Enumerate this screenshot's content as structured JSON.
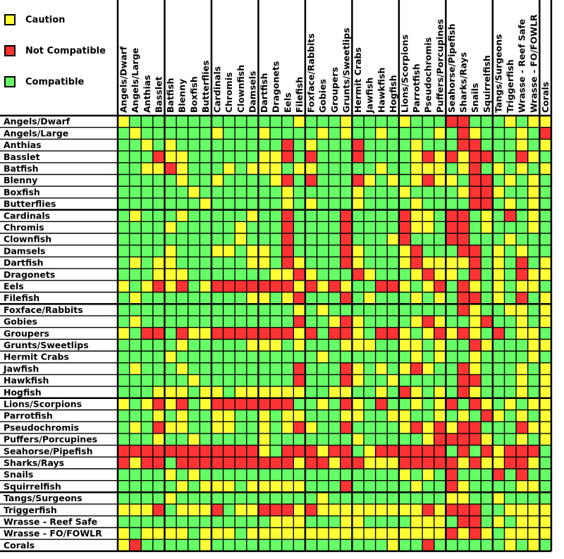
{
  "chart_data": {
    "type": "heatmap",
    "title": "",
    "legend": [
      {
        "key": "Y",
        "label": "Caution",
        "color": "#ffff33"
      },
      {
        "key": "R",
        "label": "Not Compatible",
        "color": "#ff3333"
      },
      {
        "key": "G",
        "label": "Compatible",
        "color": "#66ff66"
      }
    ],
    "legend_position": "top-left",
    "columns": [
      "Angels/Dwarf",
      "Angels/Large",
      "Anthias",
      "Basslet",
      "Batfish",
      "Blenny",
      "Boxfish",
      "Butterflies",
      "Cardinals",
      "Chromis",
      "Clownfish",
      "Damsels",
      "Dartfish",
      "Dragonets",
      "Eels",
      "Filefish",
      "Foxface/Rabbits",
      "Gobies",
      "Groupers",
      "Grunts/Sweetlips",
      "Hermit Crabs",
      "Jawfish",
      "Hawkfish",
      "Hogfish",
      "Lions/Scorpions",
      "Parrotfish",
      "Pseudochromis",
      "Puffers/Porcupines",
      "Seahorse/Pipefish",
      "Sharks/Rays",
      "Snails",
      "Squirrelfish",
      "Tangs/Surgeons",
      "Triggerfish",
      "Wrasse - Reef Safe",
      "Wrasse - FO/FOWLR",
      "Corals"
    ],
    "rows": [
      "Angels/Dwarf",
      "Angels/Large",
      "Anthias",
      "Basslet",
      "Batfish",
      "Blenny",
      "Boxfish",
      "Butterflies",
      "Cardinals",
      "Chromis",
      "Clownfish",
      "Damsels",
      "Dartfish",
      "Dragonets",
      "Eels",
      "Filefish",
      "Foxface/Rabbits",
      "Gobies",
      "Groupers",
      "Grunts/Sweetlips",
      "Hermit Crabs",
      "Jawfish",
      "Hawkfish",
      "Hogfish",
      "Lions/Scorpions",
      "Parrotfish",
      "Pseudochromis",
      "Puffers/Porcupines",
      "Seahorse/Pipefish",
      "Sharks/Rays",
      "Snails",
      "Squirrelfish",
      "Tangs/Surgeons",
      "Triggerfish",
      "Wrasse - Reef Safe",
      "Wrasse - FO/FOWLR",
      "Corals"
    ],
    "values": [
      "YGGGGGGGGGGGGGGYGGGYGGGGYGGGRRGGGYGYY",
      "GYGGGGGGYGGGYGGGGYGYGGYGGGGYGRYGGGYGR",
      "GGYGYGGGGGGGGGRGYGGGRGGGGYGGGRRGGGYGY",
      "GGGRYYGGGGGGYYRGRGGGRGGGGYRYRYRRGGRYG",
      "GGYYRYGGGYGYYYGYYGGGGGYGGYYYGYRGYGYGY",
      "GGGGGYGGYGGGGYRGRGGGRYGYGYRYYGRRGYGYG",
      "GGGGGGYGGGGGGGYGGGGGYGGGYGGGGYRRYGGYGG",
      "GGGGGGGYGGGGGGYGYGGGYGGGGYGGGGRRGYGYGYY",
      "GYGGGYGGGGGYGGRGGGGRGGGGRYYGRRGYGRGYG",
      "GGGGYGGGGGYGGGRGGGGRGGGGRYYGRRGYGGGYG",
      "GGGGGGGGGGYGGGRGGGGRGGGYRGGGRRGGGYGGG",
      "GGGGYGGGYYGYYGRGGGGRYGGGYRGGGRRGYGYGG",
      "GYGYYGGGGGGYYGRYGGGRYGGGYRYYYYRGYGRGY",
      "GGGYYYGGGGGGGYYRYGGGRYGGGYRYYGRGYGRYY",
      "YGYRYRGYRRRRRRRYRYRYGGRRYGYRGRYGYGYYG",
      "GYGGGGGGGGGYYGYRGGGRGYGGGYGYGRRGYGRGY",
      "GGGGGGGGGGGGGGGYGYGGGGGGGGGGGRYGGYYGY",
      "GYGGGGGGGGGGGGGRGGYRYGGGGYRYGGYRGGYGY",
      "YGRRGRYYRRRRRRRYRGRRYGRRYGYRYRYGRGYYG",
      "GGGGGYGGGGGYYYGYGGGYYYGGYYGYGGRYGGGYYG",
      "GGGGYGGGGGGGGGGGGYGGGGGGGYGYGGYGGGGYGG",
      "GYGGGYGGGGGGGGGRGGGRYGYGYRYGGRYGGGYGYY",
      "GGGGGGYGGGGGGGGRGGGRYGGYGGGGGRRGGGYGYG",
      "GGGYYYGYYGYYYYYYGGYYGGYGRYGYGRYGGGYGYG",
      "YGYRYRGYRRRRRRRGGYGRYGRGGYGYRGRYGYGYYYG",
      "GGGYGYGGYYGGYGYYGGGYYGGYYGGYGYGRYGYGYYR",
      "GYGRYYGGYYGGYGYRYGGRGGGGYRYRYRRGGGRYYG",
      "GGGYGGYGGGGGYGGGGGGGYGGGGGYRRRRYGGYGYG",
      "RRRRRRRRRRRRYGRRRYRRGYRRRRRRGRGRYRRRG",
      "RYRRGRRRRRRRRRRYRRYRRYYYRRRRRYRYYRRYG",
      "GGGGYGYGGGGGGGGGGGGGGGGGYGYGRGGGRGRGG",
      "GGGGGYGYYYGYYYYYGGGRGGGGGYGGRYGGGGYYG",
      "GGGGYGGGGGGGGGGGGYGGGGGGGGGGYYGGYGGGG",
      "YYYRGYYYRGYYRRRYRYYYYYYYYYRYRRRGGYYYY",
      "GGGGGGGGGGGGGYYYGGGYYGGGGYYYGRRGYGYYYG",
      "YGYYYYGYYYGYYYYYYYYYYYYYYYYYRYRYGYYYY",
      "YRGGGGGYGGGGGGGGGGGGGGGYGGRGGGGGGYGYG"
    ]
  }
}
